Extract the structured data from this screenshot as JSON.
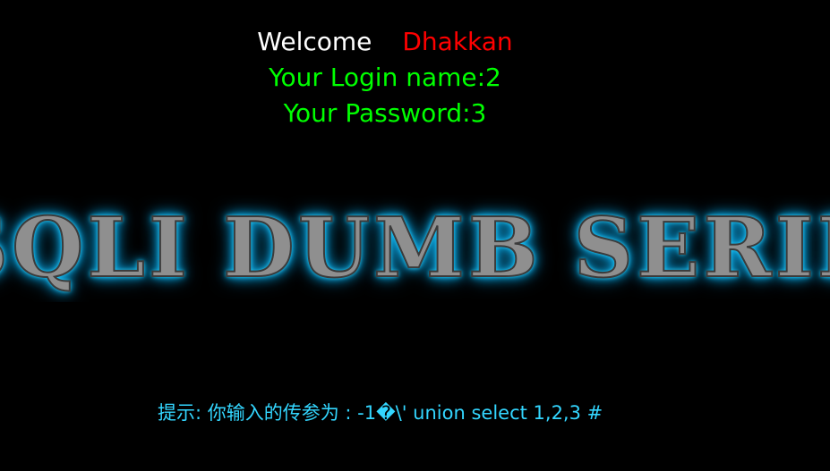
{
  "header": {
    "welcome_label": "Welcome",
    "username": "Dhakkan"
  },
  "login": {
    "login_name_text": "Your Login name:2",
    "password_text": "Your Password:3"
  },
  "banner": {
    "text": "SQLI DUMB SERIES"
  },
  "hint": {
    "text": "提示: 你输入的传参为 : -1�\\' union select 1,2,3 #"
  },
  "colors": {
    "background": "#000000",
    "welcome": "#ffffff",
    "username": "#ff0000",
    "login_info": "#00ff00",
    "hint": "#33d6ff",
    "banner_fill": "#8f8f8f",
    "banner_glow": "#12b5f0"
  }
}
